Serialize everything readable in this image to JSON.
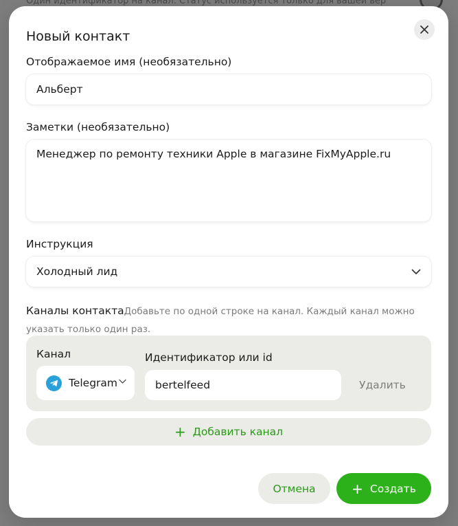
{
  "backdrop": {
    "text": "Один идентификатор на канал. Статус используется только для вашей вер"
  },
  "dialog": {
    "title": "Новый контакт",
    "close_icon": "close-icon"
  },
  "display_name": {
    "label": "Отображаемое имя (необязательно)",
    "value": "Альберт"
  },
  "notes": {
    "label": "Заметки (необязательно)",
    "value": "Менеджер по ремонту техники Apple в магазине FixMyApple.ru"
  },
  "instruction": {
    "label": "Инструкция",
    "selected": "Холодный лид",
    "icon": "chevron-down-icon"
  },
  "channels": {
    "label": "Каналы контакта",
    "hint": "Добавьте по одной строке на канал. Каждый канал можно указать только один раз.",
    "channel_label": "Канал",
    "identifier_label": "Идентификатор или id",
    "rows": [
      {
        "channel": "Telegram",
        "channel_icon": "telegram-icon",
        "identifier": "bertelfeed",
        "delete_label": "Удалить"
      }
    ],
    "add_label": "Добавить канал"
  },
  "actions": {
    "cancel_label": "Отмена",
    "create_label": "Создать"
  },
  "colors": {
    "accent": "#2db11a",
    "accent_text": "#2a9a18",
    "telegram": "#2aa1da",
    "surface": "#ebebe8"
  }
}
